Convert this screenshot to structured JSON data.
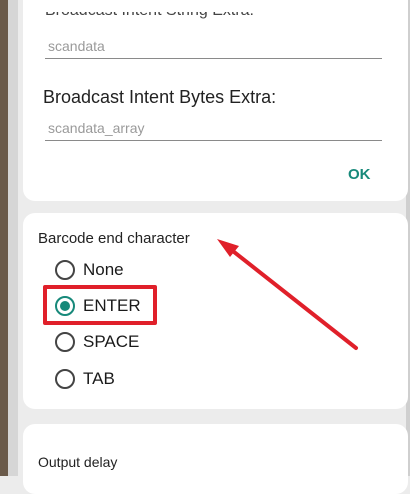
{
  "intent_settings": {
    "previous_label_partial": "Broadcast Intent String Extra:",
    "string_extra_value": "scandata",
    "bytes_extra_label": "Broadcast Intent Bytes Extra:",
    "bytes_extra_value": "scandata_array",
    "ok_label": "OK"
  },
  "barcode_end": {
    "title": "Barcode end character",
    "options": [
      {
        "label": "None",
        "selected": false
      },
      {
        "label": "ENTER",
        "selected": true
      },
      {
        "label": "SPACE",
        "selected": false
      },
      {
        "label": "TAB",
        "selected": false
      }
    ]
  },
  "output_delay": {
    "title": "Output delay"
  },
  "annotation": {
    "color": "#e0202a",
    "highlighted_option": "ENTER"
  },
  "colors": {
    "accent": "#17897a",
    "background": "#ececec",
    "card": "#ffffff"
  }
}
